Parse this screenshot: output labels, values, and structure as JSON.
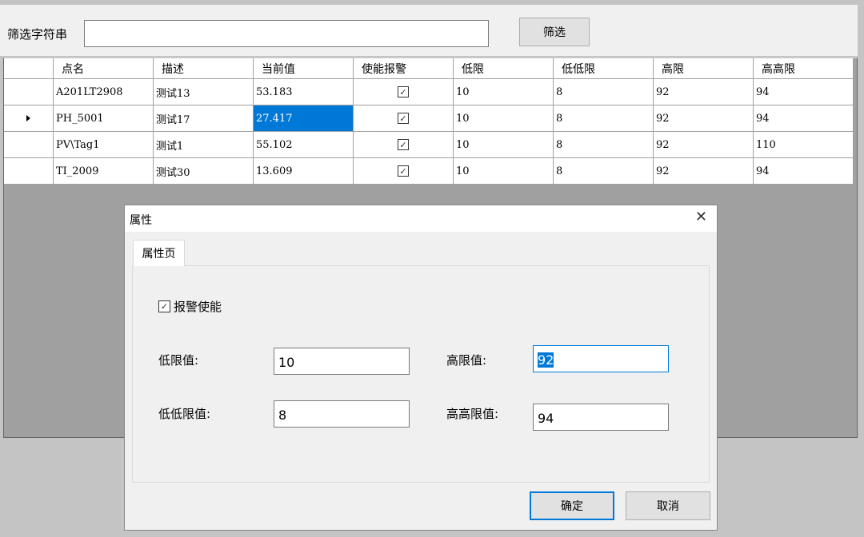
{
  "filter": {
    "label": "筛选字符串",
    "value": "",
    "button": "筛选"
  },
  "grid": {
    "columns": [
      "点名",
      "描述",
      "当前值",
      "使能报警",
      "低限",
      "低低限",
      "高限",
      "高高限"
    ],
    "rows": [
      {
        "name": "A201LT2908",
        "desc": "测试13",
        "value": "53.183",
        "alarm": true,
        "low": "10",
        "lowlow": "8",
        "high": "92",
        "highhigh": "94"
      },
      {
        "name": "PH_5001",
        "desc": "测试17",
        "value": "27.417",
        "alarm": true,
        "low": "10",
        "lowlow": "8",
        "high": "92",
        "highhigh": "94"
      },
      {
        "name": "PV\\Tag1",
        "desc": "测试1",
        "value": "55.102",
        "alarm": true,
        "low": "10",
        "lowlow": "8",
        "high": "92",
        "highhigh": "110"
      },
      {
        "name": "TI_2009",
        "desc": "测试30",
        "value": "13.609",
        "alarm": true,
        "low": "10",
        "lowlow": "8",
        "high": "92",
        "highhigh": "94"
      }
    ],
    "current_row": 1
  },
  "dialog": {
    "title": "属性",
    "close_icon": "close-icon",
    "tab": "属性页",
    "alarm_enable": {
      "label": "报警使能",
      "checked": true
    },
    "low": {
      "label": "低限值:",
      "value": "10"
    },
    "high": {
      "label": "高限值:",
      "value": "92"
    },
    "lowlow": {
      "label": "低低限值:",
      "value": "8"
    },
    "highhigh": {
      "label": "高高限值:",
      "value": "94"
    },
    "ok": "确定",
    "cancel": "取消"
  },
  "colors": {
    "selection": "#0078d7",
    "background": "#c4c4c4",
    "window": "#f0f0f0"
  }
}
